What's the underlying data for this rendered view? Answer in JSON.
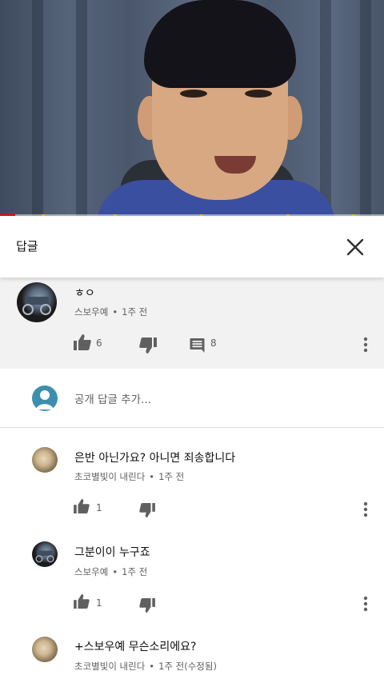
{
  "video": {
    "progress_percent": 4
  },
  "replies_panel": {
    "title": "답글",
    "close_icon": "close-icon"
  },
  "parent_comment": {
    "text": "ㅎㅇ",
    "author": "스보우예",
    "time": "1주 전",
    "likes": "6",
    "reply_count": "8"
  },
  "add_reply": {
    "placeholder": "공개 답글 추가..."
  },
  "replies": [
    {
      "text": "은반 아닌가요?  아니면 죄송합니다",
      "author": "초코별빛이 내린다",
      "time": "1주 전",
      "likes": "1"
    },
    {
      "text": "그분이이 누구죠",
      "author": "스보우예",
      "time": "1주 전",
      "likes": "1"
    },
    {
      "text": "+스보우예 무슨소리에요?",
      "author": "초코별빛이 내린다",
      "time": "1주 전(수정됨)"
    }
  ],
  "colors": {
    "progress": "#ff0000",
    "highlight_bg": "#f2f2f2",
    "meta_text": "#606060",
    "icon": "#606060"
  }
}
